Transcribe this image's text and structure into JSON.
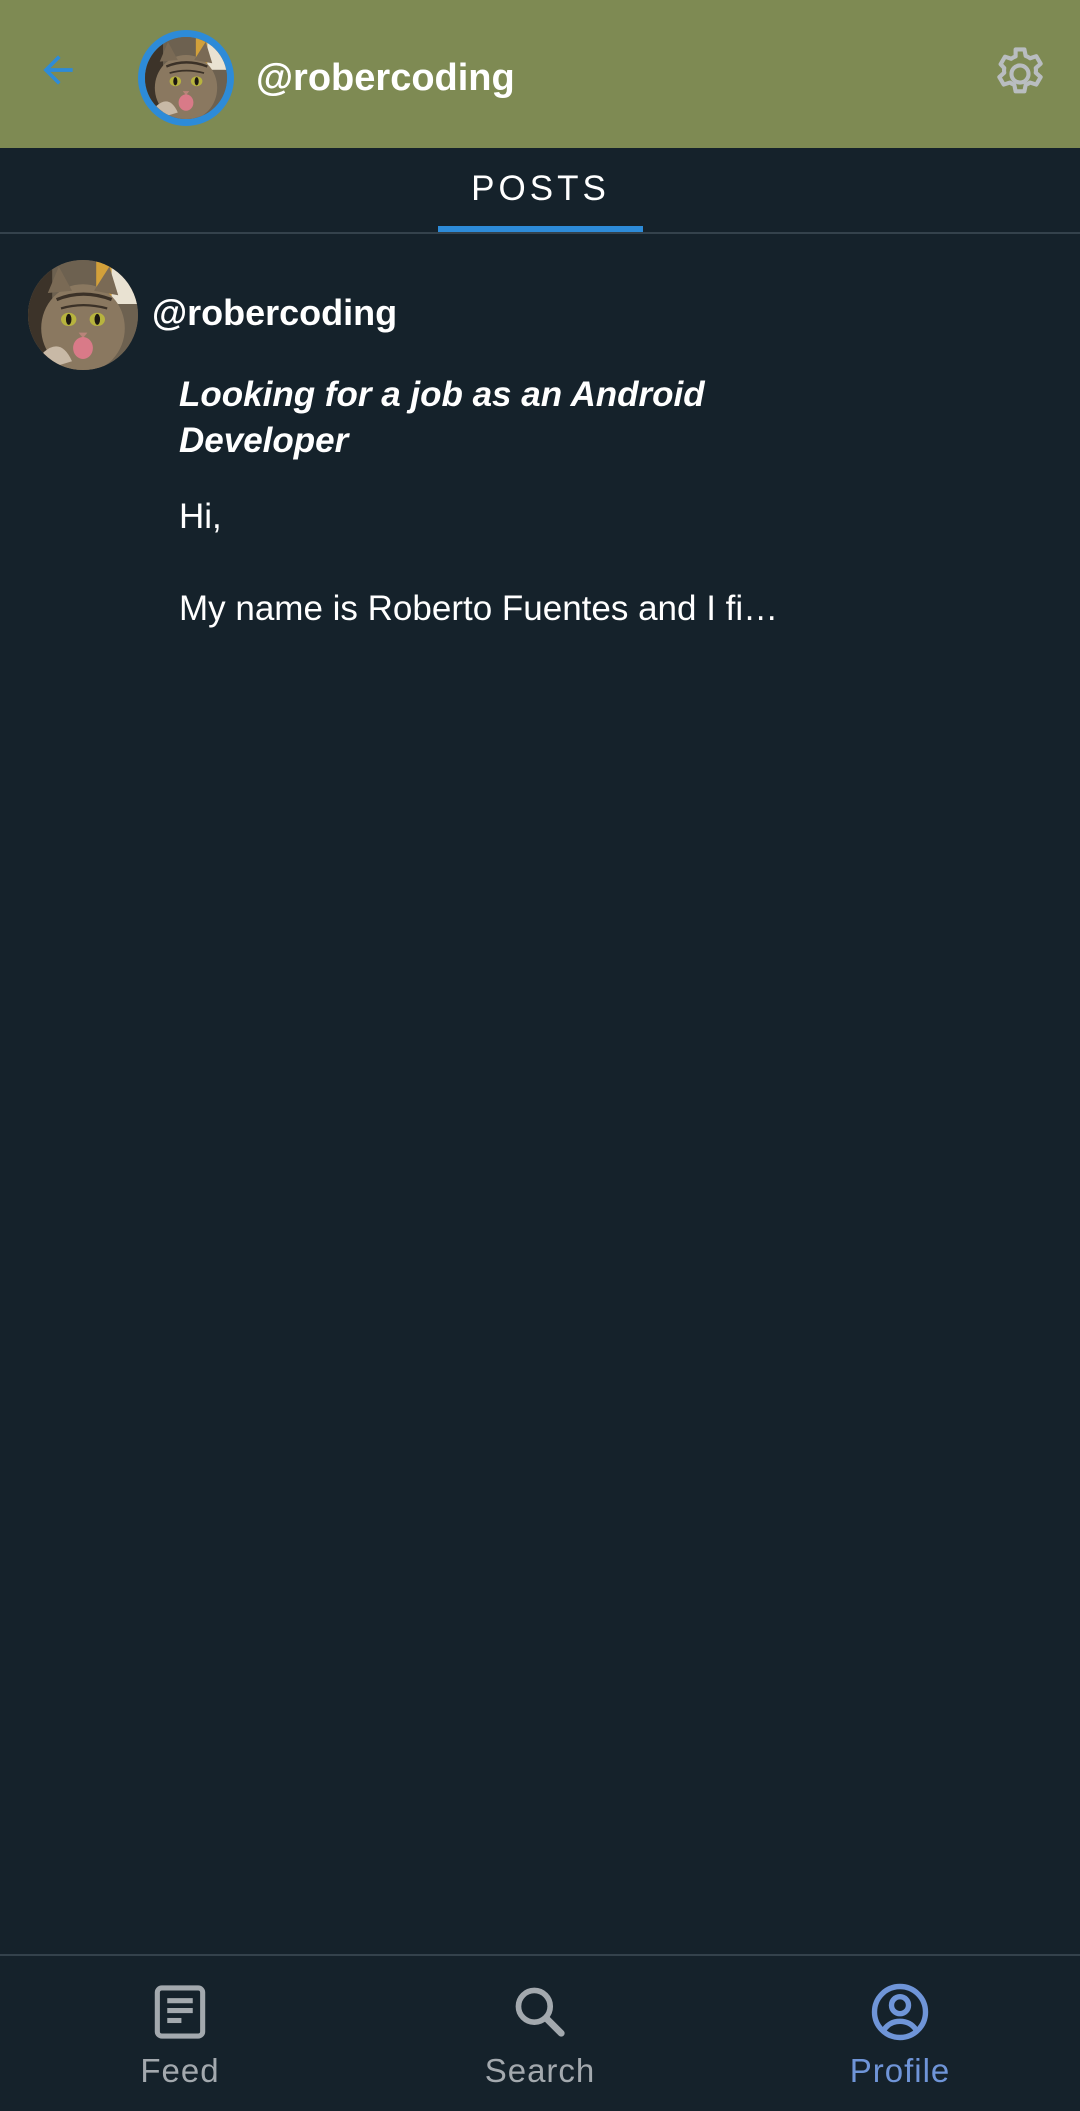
{
  "colors": {
    "app_bar": "#7e8a53",
    "background": "#15222b",
    "accent": "#2d8bd8",
    "nav_active": "#6f95d8",
    "nav_inactive": "#a3a9ae"
  },
  "header": {
    "back_icon": "arrow-left-icon",
    "avatar_icon": "cat-avatar",
    "username": "@robercoding",
    "settings_icon": "gear-icon"
  },
  "tabs": [
    {
      "label": "POSTS",
      "selected": true
    }
  ],
  "posts": [
    {
      "username": "@robercoding",
      "title": "Looking for a job as an Android Developer",
      "body": "Hi,\n\nMy name is Roberto Fuentes and I fi…"
    }
  ],
  "bottom_nav": {
    "items": [
      {
        "label": "Feed",
        "icon": "feed-article-icon",
        "active": false
      },
      {
        "label": "Search",
        "icon": "search-icon",
        "active": false
      },
      {
        "label": "Profile",
        "icon": "account-circle-icon",
        "active": true
      }
    ]
  }
}
